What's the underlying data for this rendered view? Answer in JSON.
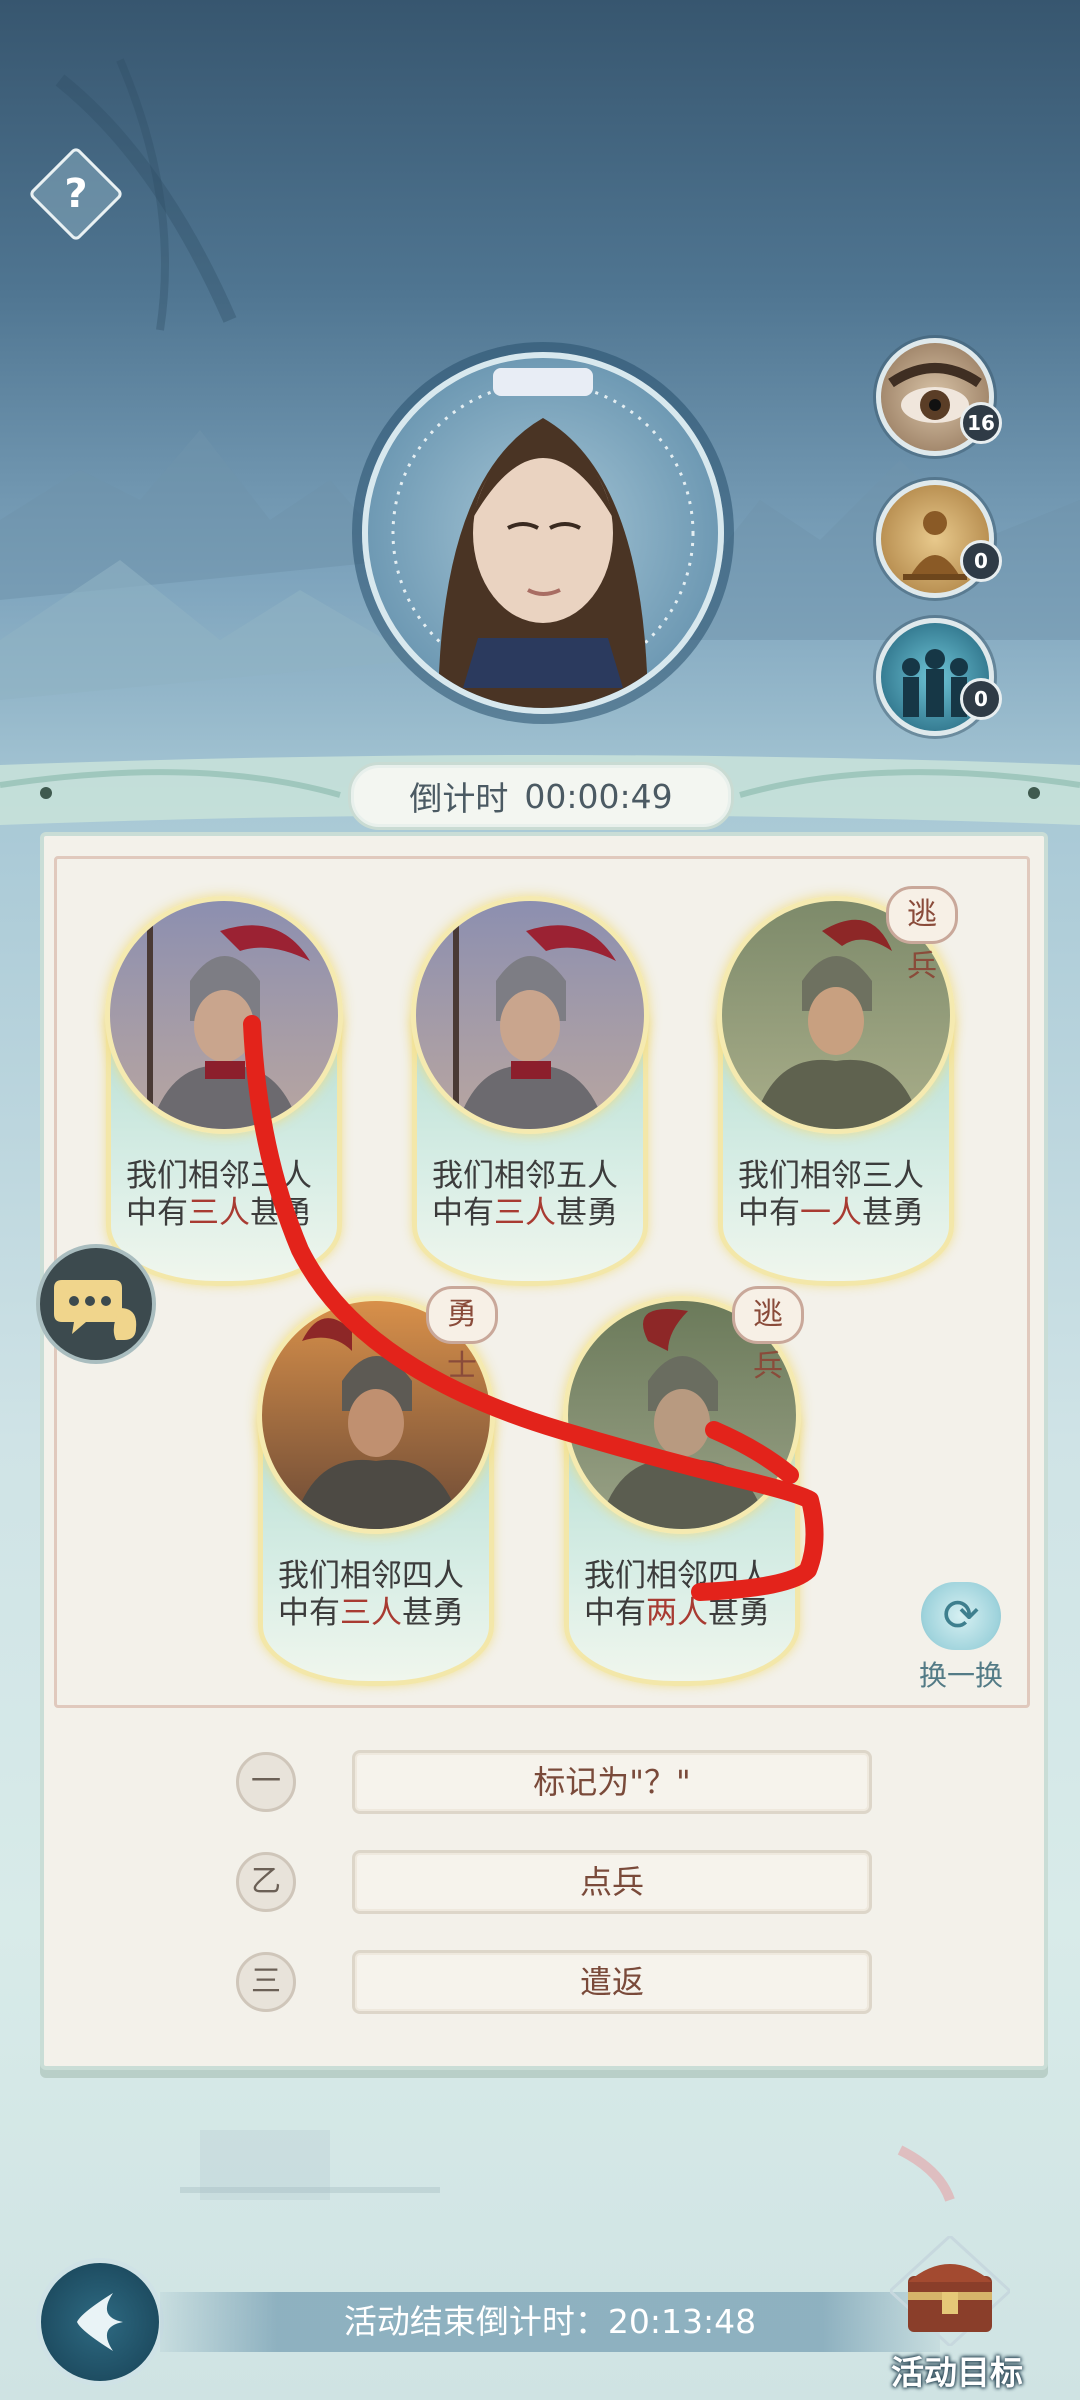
{
  "help": {
    "glyph": "?"
  },
  "hero": {
    "name": "portrait"
  },
  "side_icons": [
    {
      "icon": "eye-icon",
      "count": "16"
    },
    {
      "icon": "meditation-icon",
      "count": "0"
    },
    {
      "icon": "crowd-icon",
      "count": "0"
    }
  ],
  "countdown": {
    "label": "倒计时",
    "time": "00:00:49"
  },
  "cards": [
    {
      "line1": "我们相邻三人",
      "line2_pre": "中有",
      "line2_hl": "三人",
      "line2_post": "甚勇",
      "tag": "",
      "theme": "dusk"
    },
    {
      "line1": "我们相邻五人",
      "line2_pre": "中有",
      "line2_hl": "三人",
      "line2_post": "甚勇",
      "tag": "",
      "theme": "dusk"
    },
    {
      "line1": "我们相邻三人",
      "line2_pre": "中有",
      "line2_hl": "一人",
      "line2_post": "甚勇",
      "tag": "逃兵",
      "theme": "green"
    },
    {
      "line1": "我们相邻四人",
      "line2_pre": "中有",
      "line2_hl": "三人",
      "line2_post": "甚勇",
      "tag": "勇士",
      "theme": "fire"
    },
    {
      "line1": "我们相邻四人",
      "line2_pre": "中有",
      "line2_hl": "两人",
      "line2_post": "甚勇",
      "tag": "逃兵",
      "theme": "green"
    }
  ],
  "refresh": {
    "label": "换一换",
    "icon": "refresh-icon"
  },
  "chat": {
    "icon": "chat-icon"
  },
  "actions": [
    {
      "num": "一",
      "label": "标记为\"？\""
    },
    {
      "num": "乙",
      "label": "点兵"
    },
    {
      "num": "三",
      "label": "遣返"
    }
  ],
  "footer": {
    "countdown": "活动结束倒计时：20:13:48",
    "goal_label": "活动目标"
  },
  "colors": {
    "highlight": "#a83b32",
    "stroke": "#e3231b",
    "panel": "#f3f1ea"
  }
}
